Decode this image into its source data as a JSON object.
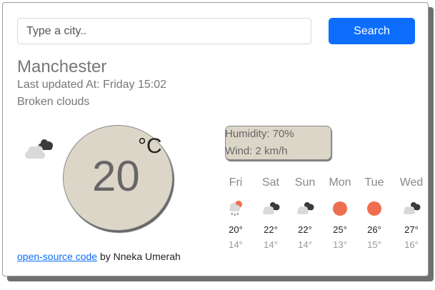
{
  "search": {
    "placeholder": "Type a city..",
    "value": "",
    "button_label": "Search"
  },
  "current": {
    "city": "Manchester",
    "last_updated": "Last updated At: Friday 15:02",
    "description": "Broken clouds",
    "icon": "broken-clouds-icon",
    "temperature": "20",
    "unit": "°C",
    "humidity": "Humidity: 70%",
    "wind": "Wind: 2 km/h"
  },
  "forecast": [
    {
      "day": "Fri",
      "icon": "rain-icon",
      "max": "20°",
      "min": "14°"
    },
    {
      "day": "Sat",
      "icon": "broken-clouds-icon",
      "max": "22°",
      "min": "14°"
    },
    {
      "day": "Sun",
      "icon": "broken-clouds-icon",
      "max": "22°",
      "min": "14°"
    },
    {
      "day": "Mon",
      "icon": "sun-icon",
      "max": "25°",
      "min": "13°"
    },
    {
      "day": "Tue",
      "icon": "sun-icon",
      "max": "26°",
      "min": "15°"
    },
    {
      "day": "Wed",
      "icon": "broken-clouds-icon",
      "max": "27°",
      "min": "16°"
    }
  ],
  "footer": {
    "link_text": "open-source code",
    "byline": " by Nneka Umerah"
  },
  "colors": {
    "accent": "#0d6efd",
    "panel": "#dcd6c8",
    "sun": "#ee6e4f"
  }
}
